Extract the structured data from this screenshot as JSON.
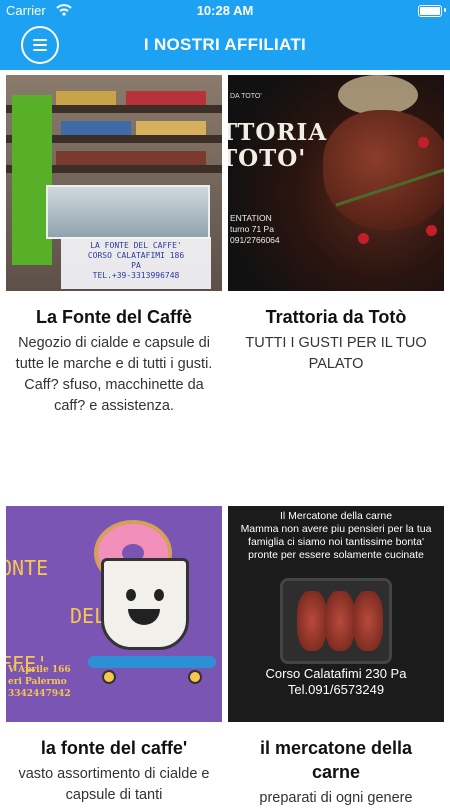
{
  "status_bar": {
    "carrier": "Carrier",
    "time": "10:28 AM"
  },
  "header": {
    "title": "I NOSTRI AFFILIATI"
  },
  "cards": [
    {
      "name": "La Fonte del Caffè",
      "description": "Negozio di cialde e capsule di tutte le marche e di tutti i gusti. Caff? sfuso, macchinette da caff? e assistenza.",
      "image_text": [
        "LA FONTE DEL CAFFE'",
        "CORSO CALATAFIMI 186",
        "PA",
        "TEL.+39-3313996748"
      ]
    },
    {
      "name": "Trattoria da Totò",
      "description": "TUTTI I GUSTI PER IL TUO PALATO",
      "image_text": [
        "DA TOTO'",
        "TTORIA",
        "TOTO'",
        "ENTATION",
        "turno 71 Pa",
        "091/2766064"
      ]
    },
    {
      "name": "la fonte del caffe'",
      "description": "vasto assortimento di cialde e capsule di tanti",
      "image_text": [
        "ONTE",
        "DEL",
        "FFE'",
        "V Aprile 166",
        "eri Palermo",
        "3342447942"
      ]
    },
    {
      "name": "il mercatone della carne",
      "description": "preparati di ogni genere",
      "image_text": [
        "Il Mercatone della carne",
        "Mamma non avere piu pensieri per la tua famiglia ci siamo noi tantissime bonta' pronte per essere solamente cucinate",
        "Corso Calatafimi 230 Pa",
        "Tel.091/6573249"
      ]
    }
  ]
}
